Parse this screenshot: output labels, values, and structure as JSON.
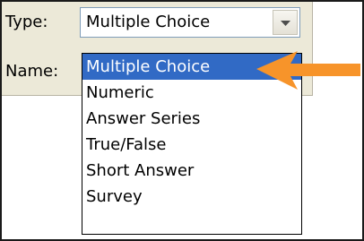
{
  "form": {
    "type_label": "Type:",
    "name_label": "Name:"
  },
  "type_select": {
    "value": "Multiple Choice",
    "options": [
      {
        "label": "Multiple Choice",
        "selected": true
      },
      {
        "label": "Numeric",
        "selected": false
      },
      {
        "label": "Answer Series",
        "selected": false
      },
      {
        "label": "True/False",
        "selected": false
      },
      {
        "label": "Short Answer",
        "selected": false
      },
      {
        "label": "Survey",
        "selected": false
      }
    ]
  },
  "icons": {
    "dropdown_button": "chevron-down-icon",
    "callout": "orange-arrow-left-icon"
  },
  "colors": {
    "panel_background": "#ece9d8",
    "selection_highlight": "#316ac5",
    "selection_text": "#ffffff",
    "callout_arrow": "#f7942a"
  }
}
